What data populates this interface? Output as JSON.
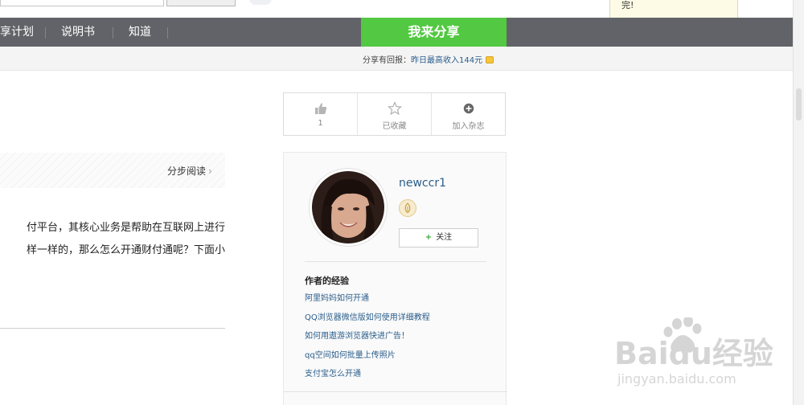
{
  "notice": {
    "text": "完!"
  },
  "nav": {
    "items": [
      "享计划",
      "说明书",
      "知道"
    ],
    "share_label": "我来分享"
  },
  "subbar": {
    "prefix": "分享有回报：",
    "highlight": "昨日最高收入144元"
  },
  "article": {
    "step_read_label": "分步阅读",
    "intro_lines": [
      "付平台，其核心业务是帮助在互联网上进行",
      "样一样的，那么怎么开通财付通呢？下面小"
    ]
  },
  "actions": [
    {
      "label": "1",
      "icon": "thumb-up-icon"
    },
    {
      "label": "已收藏",
      "icon": "star-icon"
    },
    {
      "label": "加入杂志",
      "icon": "plus-circle-icon"
    }
  ],
  "author": {
    "name": "newccr1",
    "follow_label": "关注",
    "experience_title": "作者的经验",
    "experiences": [
      "阿里妈妈如何开通",
      "QQ浏览器微信版如何使用详细教程",
      "如何用遨游浏览器快进广告！",
      "qq空间如何批量上传照片",
      "支付宝怎么开通"
    ]
  },
  "watermark": {
    "line1": "Baidu经验",
    "line2": "jingyan.baidu.com"
  },
  "colors": {
    "nav_bg": "#626368",
    "share_green": "#53c842",
    "link_blue": "#2a5d8b"
  }
}
